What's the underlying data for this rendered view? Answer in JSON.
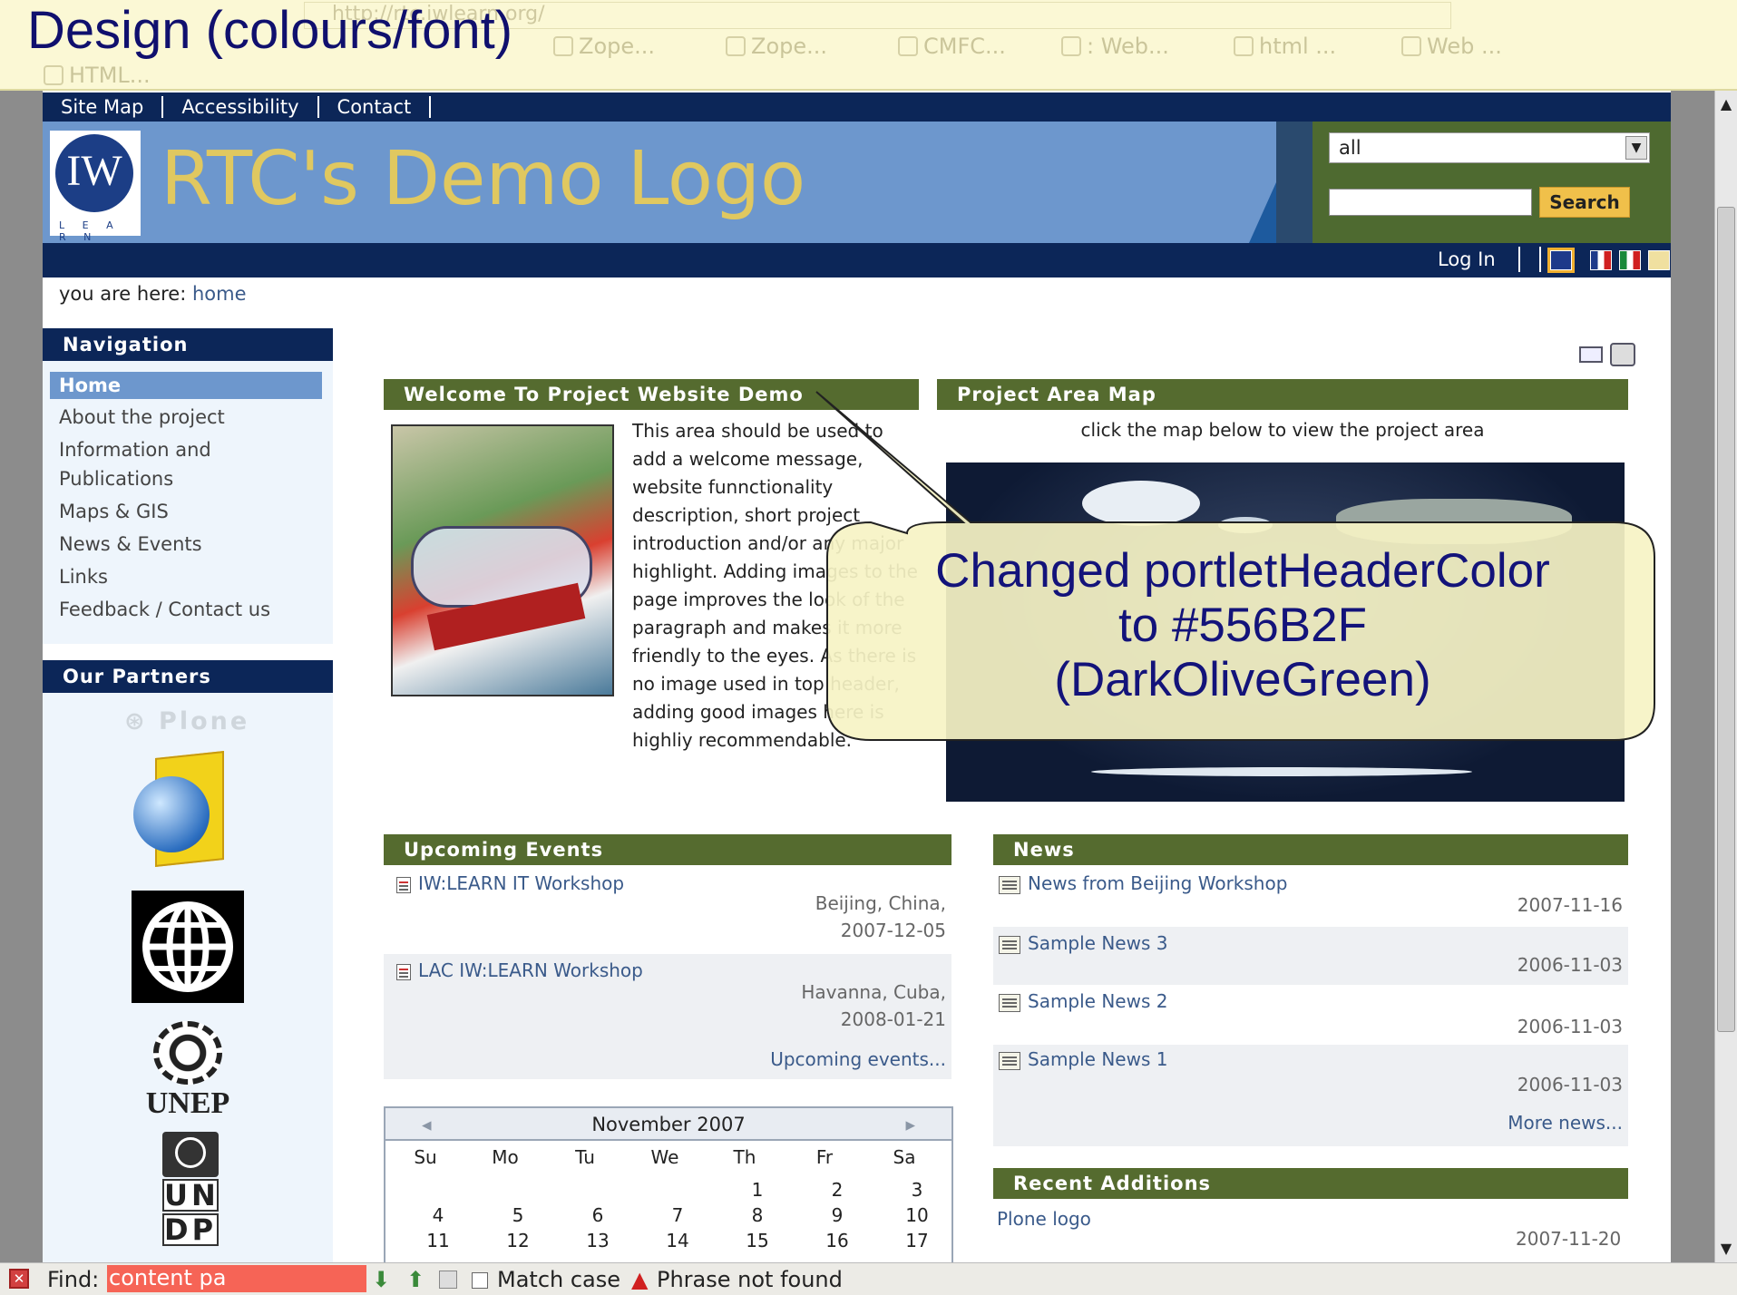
{
  "slide": {
    "title": "Design (colours/font)"
  },
  "browser": {
    "url": "http://rtc.iwlearn.org/",
    "tabs": [
      "Zope...",
      "Zope...",
      "CMFC...",
      ": Web...",
      "html ...",
      "Web ...",
      "HTML..."
    ]
  },
  "site": {
    "top_links": [
      "Site Map",
      "Accessibility",
      "Contact"
    ],
    "logo_mark": "IW",
    "logo_tagline": "L E A R N",
    "logo_text": "RTC's Demo Logo",
    "search": {
      "scope": "all",
      "button": "Search"
    },
    "login": "Log In",
    "breadcrumb": {
      "prefix": "you are here:",
      "current": "home"
    }
  },
  "navigation": {
    "title": "Navigation",
    "items": [
      "Home",
      "About the project",
      "Information and Publications",
      "Maps & GIS",
      "News & Events",
      "Links",
      "Feedback / Contact us"
    ]
  },
  "partners": {
    "title": "Our Partners",
    "plone": "Plone",
    "unep": "UNEP",
    "undp_a": "UN",
    "undp_b": "DP"
  },
  "welcome": {
    "title": "Welcome To Project Website Demo",
    "body": "This area should be used to add a welcome message, website funnctionality description, short project introduction and/or any major  highlight. Adding images to the page improves the look of the paragraph and makes it more friendly to the eyes. As there is no image used in top header, adding good images here is highliy recommendable."
  },
  "map": {
    "title": "Project Area Map",
    "caption": "click the map below to view the project area"
  },
  "events": {
    "title": "Upcoming Events",
    "items": [
      {
        "name": "IW:LEARN IT Workshop",
        "location": "Beijing, China,",
        "date": "2007-12-05"
      },
      {
        "name": "LAC IW:LEARN Workshop",
        "location": "Havanna, Cuba,",
        "date": "2008-01-21"
      }
    ],
    "more": "Upcoming events..."
  },
  "calendar": {
    "month": "November 2007",
    "prev": "◂",
    "next": "▸",
    "days": [
      "Su",
      "Mo",
      "Tu",
      "We",
      "Th",
      "Fr",
      "Sa"
    ],
    "rows": [
      [
        "",
        "",
        "",
        "",
        "1",
        "2",
        "3"
      ],
      [
        "4",
        "5",
        "6",
        "7",
        "8",
        "9",
        "10"
      ],
      [
        "11",
        "12",
        "13",
        "14",
        "15",
        "16",
        "17"
      ]
    ]
  },
  "news": {
    "title": "News",
    "items": [
      {
        "title": "News from Beijing Workshop",
        "date": "2007-11-16"
      },
      {
        "title": "Sample News 3",
        "date": "2006-11-03"
      },
      {
        "title": "Sample News 2",
        "date": "2006-11-03"
      },
      {
        "title": "Sample News 1",
        "date": "2006-11-03"
      }
    ],
    "more": "More news..."
  },
  "recent": {
    "title": "Recent Additions",
    "items": [
      {
        "title": "Plone logo",
        "date": "2007-11-20"
      }
    ]
  },
  "callout": {
    "line1": "Changed portletHeaderColor",
    "line2": "to #556B2F",
    "line3": "(DarkOliveGreen)"
  },
  "findbar": {
    "label": "Find:",
    "value": "content pa",
    "match_case": "Match case",
    "status": "Phrase not found"
  },
  "colors": {
    "portlet_header": "#556B2F",
    "top_bar": "#0C2658",
    "banner": "#6D97CD",
    "logo_text": "#E0C860"
  }
}
